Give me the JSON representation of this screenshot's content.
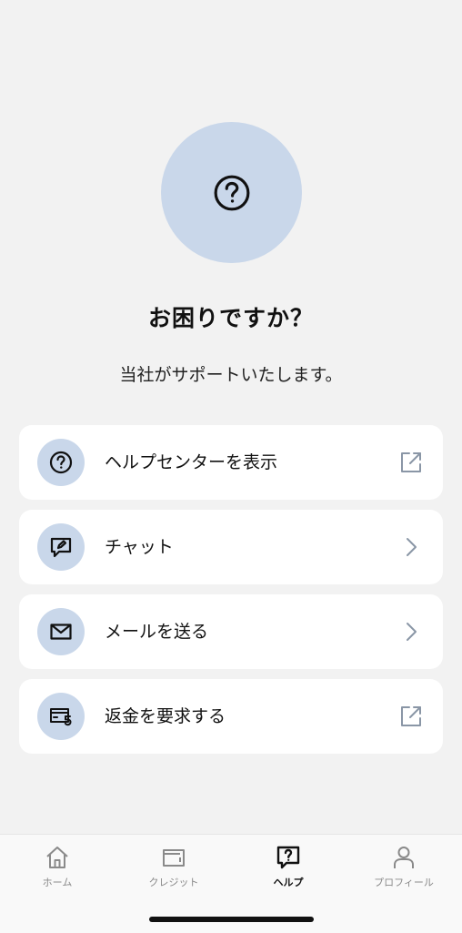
{
  "hero": {
    "icon": "question-circle-icon",
    "title": "お困りですか？",
    "subtitle": "当社がサポートいたします。"
  },
  "menu": [
    {
      "label": "ヘルプセンターを表示",
      "icon": "question-circle-icon",
      "trail": "external-link-icon"
    },
    {
      "label": "チャット",
      "icon": "chat-edit-icon",
      "trail": "chevron-right-icon"
    },
    {
      "label": "メールを送る",
      "icon": "envelope-icon",
      "trail": "chevron-right-icon"
    },
    {
      "label": "返金を要求する",
      "icon": "card-refund-icon",
      "trail": "external-link-icon"
    }
  ],
  "tabbar": {
    "tabs": [
      {
        "label": "ホーム",
        "icon": "home-icon",
        "active": false
      },
      {
        "label": "クレジット",
        "icon": "wallet-icon",
        "active": false
      },
      {
        "label": "ヘルプ",
        "icon": "help-chat-icon",
        "active": true
      },
      {
        "label": "プロフィール",
        "icon": "person-icon",
        "active": false
      }
    ]
  },
  "colors": {
    "background": "#f2f2f2",
    "accent_circle": "#c9d7ea",
    "card": "#ffffff",
    "trail_icon": "#8a96a6",
    "tab_inactive": "#8a8a8a"
  }
}
